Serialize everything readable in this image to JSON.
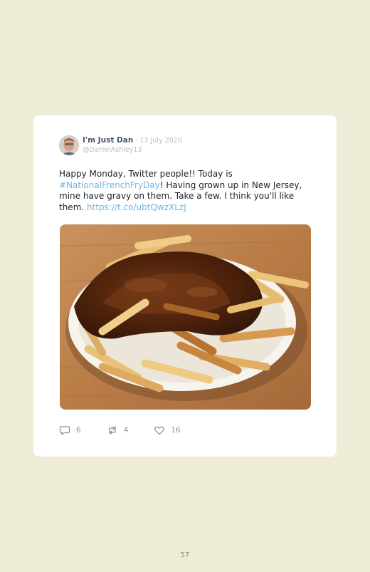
{
  "tweet": {
    "author_name": "I'm Just Dan",
    "separator": " · ",
    "date": "13 July 2020",
    "handle": "@DanielAshley13",
    "text_1": "Happy Monday, Twitter people!! Today is ",
    "hashtag": "#NationalFrenchFryDay",
    "text_2": "! Having grown up in New Jersey, mine have gravy on them. Take a few. I think you'll like them. ",
    "link": "https://t.co/ubtQwzXLzJ",
    "photo_icon": "photo-of-fries-with-gravy-on-plate"
  },
  "actions": {
    "reply_count": "6",
    "retweet_count": "4",
    "like_count": "16",
    "reply_icon": "speech-bubble-icon",
    "retweet_icon": "retweet-arrows-icon",
    "like_icon": "heart-icon"
  },
  "page": {
    "number": "57"
  },
  "colors": {
    "page_background": "#eeebd6",
    "card_background": "#ffffff",
    "link_blue": "#6fb7e3",
    "name_gray": "#4a5866",
    "muted_gray": "#b6bcc3"
  }
}
